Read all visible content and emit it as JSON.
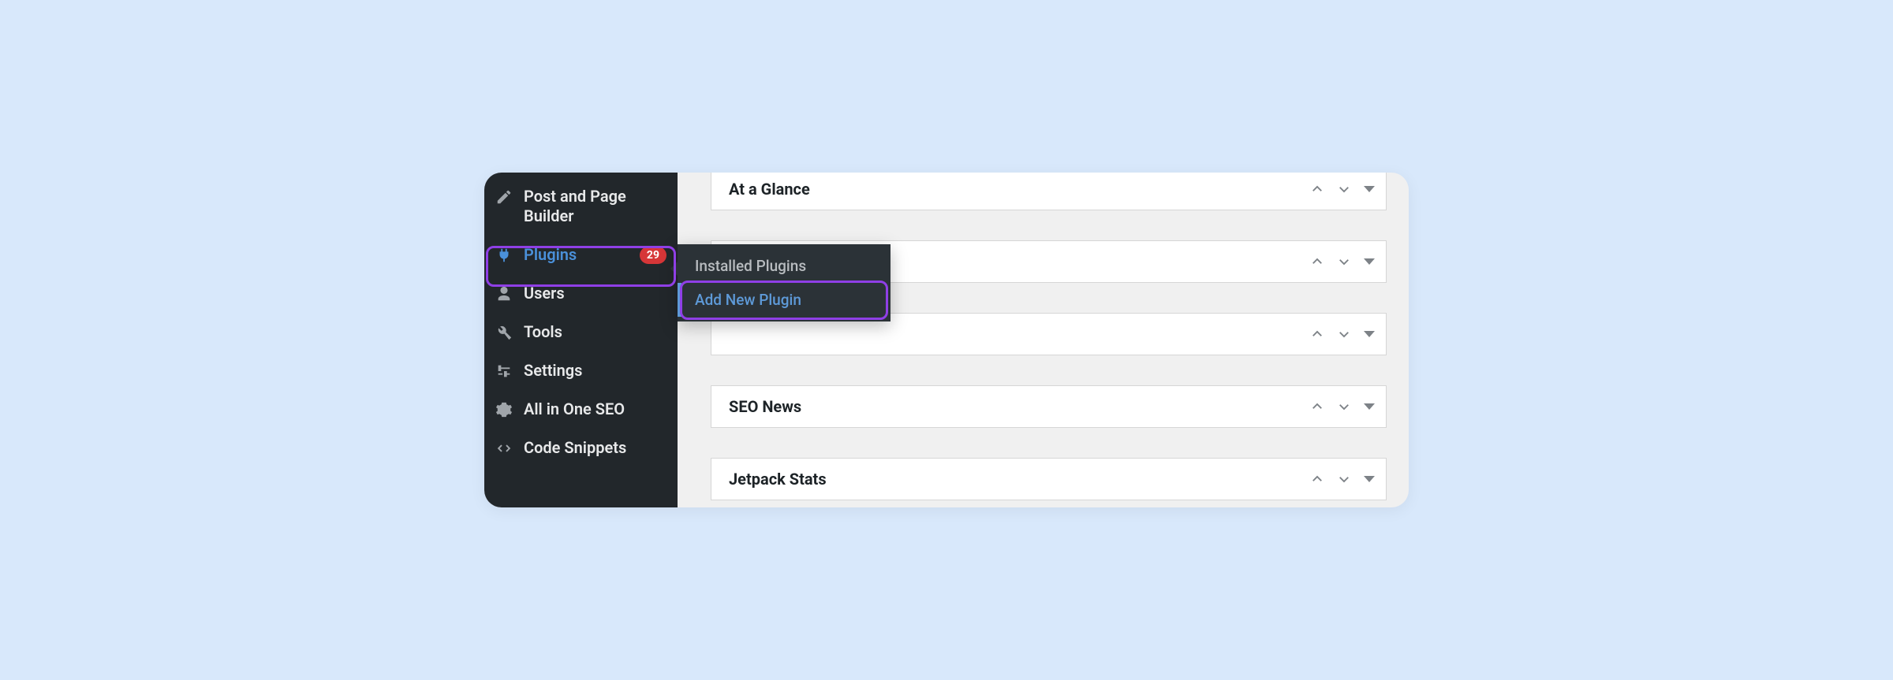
{
  "sidebar": {
    "items": [
      {
        "label": "Post and Page Builder",
        "icon": "pencil-icon"
      },
      {
        "label": "Plugins",
        "icon": "plug-icon",
        "badge": "29",
        "active": true
      },
      {
        "label": "Users",
        "icon": "user-icon"
      },
      {
        "label": "Tools",
        "icon": "wrench-icon"
      },
      {
        "label": "Settings",
        "icon": "sliders-icon"
      },
      {
        "label": "All in One SEO",
        "icon": "gear-icon"
      },
      {
        "label": "Code Snippets",
        "icon": "code-icon"
      }
    ]
  },
  "flyout": {
    "items": [
      {
        "label": "Installed Plugins",
        "current": false
      },
      {
        "label": "Add New Plugin",
        "current": true
      }
    ]
  },
  "widgets": [
    {
      "title": "At a Glance"
    },
    {
      "title": ""
    },
    {
      "title": ""
    },
    {
      "title": "SEO News"
    },
    {
      "title": "Jetpack Stats"
    }
  ]
}
